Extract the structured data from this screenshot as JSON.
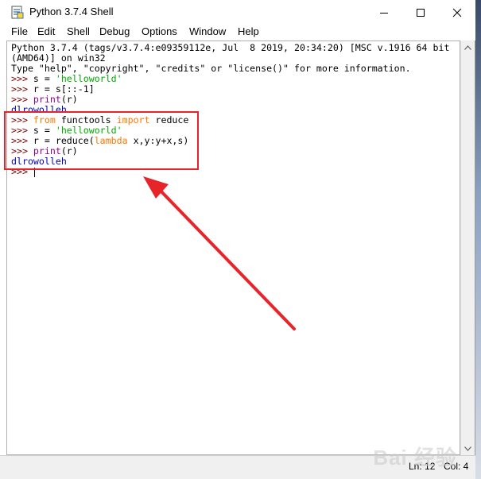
{
  "window": {
    "title": "Python 3.7.4 Shell",
    "icon": "python-idle-icon"
  },
  "controls": {
    "minimize_icon": "minimize-icon",
    "maximize_icon": "maximize-icon",
    "close_icon": "close-icon"
  },
  "menu": [
    {
      "key": "F",
      "rest": "ile"
    },
    {
      "key": "E",
      "rest": "dit"
    },
    {
      "key": "She",
      "rest": "ll",
      "u_after": "l"
    },
    {
      "key": "D",
      "rest": "ebug"
    },
    {
      "key": "O",
      "rest": "ptions"
    },
    {
      "key": "W",
      "rest": "indow"
    },
    {
      "key": "H",
      "rest": "elp"
    }
  ],
  "menu_labels": [
    "File",
    "Edit",
    "Shell",
    "Debug",
    "Options",
    "Window",
    "Help"
  ],
  "shell": {
    "banner_1": "Python 3.7.4 (tags/v3.7.4:e09359112e, Jul  8 2019, 20:34:20) [MSC v.1916 64 bit",
    "banner_2": "(AMD64)] on win32",
    "banner_3": "Type \"help\", \"copyright\", \"credits\" or \"license()\" for more information.",
    "prompt": ">>> ",
    "l1_a": "s = ",
    "l1_str": "'helloworld'",
    "l2": "r = s[::-1]",
    "l3_bi": "print",
    "l3_rest": "(r)",
    "out1": "dlrowolleh",
    "l4_kw1": "from",
    "l4_mid": " functools ",
    "l4_kw2": "import",
    "l4_end": " reduce",
    "l5_a": "s = ",
    "l5_str": "'helloworld'",
    "l6_a": "r = reduce(",
    "l6_kw": "lambda",
    "l6_end": " x,y:y+x,s)",
    "l7_bi": "print",
    "l7_rest": "(r)",
    "out2": "dlrowolleh",
    "final_prompt": ">>>"
  },
  "status": {
    "ln": "Ln: 12",
    "col": "Col: 4"
  },
  "watermark": "Bai 经验",
  "colors": {
    "annotation_red": "#e8242b",
    "prompt": "#800000",
    "keyword": "#ff7700",
    "builtin": "#900090",
    "string": "#00aa00",
    "output": "#0000c0"
  }
}
